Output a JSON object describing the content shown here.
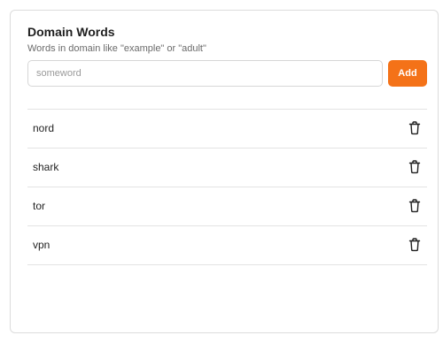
{
  "card": {
    "title": "Domain Words",
    "description": "Words in domain like \"example\" or \"adult\""
  },
  "form": {
    "placeholder": "someword",
    "value": "",
    "add_label": "Add"
  },
  "words": [
    {
      "text": "nord",
      "action_icon": "trash-icon"
    },
    {
      "text": "shark",
      "action_icon": "trash-icon"
    },
    {
      "text": "tor",
      "action_icon": "trash-icon"
    },
    {
      "text": "vpn",
      "action_icon": "trash-icon"
    }
  ],
  "colors": {
    "accent": "#f47218",
    "border": "#dcdcdc",
    "text": "#1f1f1f",
    "muted": "#6b6b6b"
  }
}
